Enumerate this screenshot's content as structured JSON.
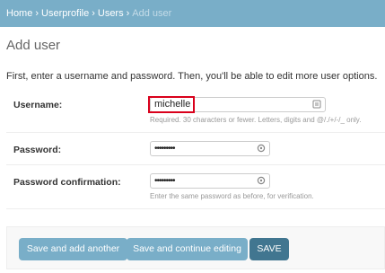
{
  "breadcrumbs": {
    "home": "Home",
    "app": "Userprofile",
    "model": "Users",
    "current": "Add user",
    "separator": "›"
  },
  "page": {
    "title": "Add user",
    "intro": "First, enter a username and password. Then, you'll be able to edit more user options."
  },
  "form": {
    "username": {
      "label": "Username:",
      "value": "michelle",
      "help": "Required. 30 characters or fewer. Letters, digits and @/./+/-/_ only.",
      "icon": "contact-card-icon"
    },
    "password": {
      "label": "Password:",
      "value": "•••••••••",
      "icon": "key-icon"
    },
    "password_confirm": {
      "label": "Password confirmation:",
      "value": "•••••••••",
      "help": "Enter the same password as before, for verification.",
      "icon": "key-icon"
    }
  },
  "actions": {
    "save_add_another": "Save and add another",
    "save_continue": "Save and continue editing",
    "save": "SAVE"
  },
  "colors": {
    "header_bg": "#79aec8",
    "button_light": "#79aec8",
    "button_primary": "#417690",
    "highlight": "#d9001b"
  }
}
